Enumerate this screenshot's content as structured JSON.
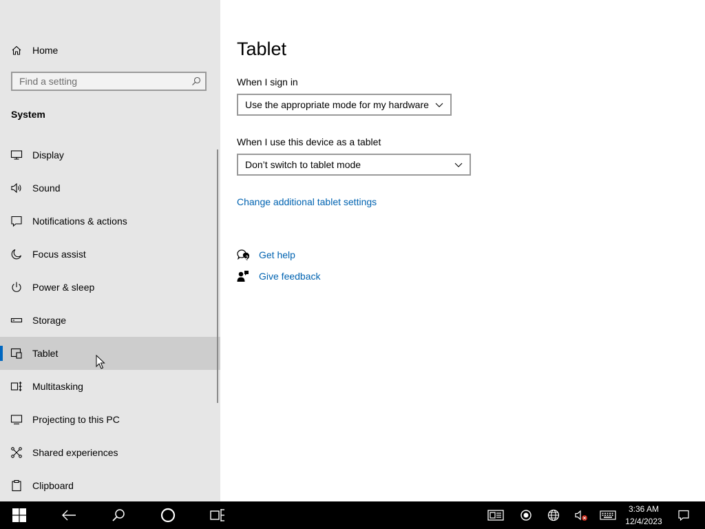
{
  "sidebar": {
    "home_label": "Home",
    "search_placeholder": "Find a setting",
    "section_title": "System",
    "items": [
      {
        "label": "Display",
        "icon": "monitor-icon"
      },
      {
        "label": "Sound",
        "icon": "speaker-icon"
      },
      {
        "label": "Notifications & actions",
        "icon": "notification-icon"
      },
      {
        "label": "Focus assist",
        "icon": "moon-icon"
      },
      {
        "label": "Power & sleep",
        "icon": "power-icon"
      },
      {
        "label": "Storage",
        "icon": "storage-icon"
      },
      {
        "label": "Tablet",
        "icon": "tablet-icon",
        "active": true
      },
      {
        "label": "Multitasking",
        "icon": "multitasking-icon"
      },
      {
        "label": "Projecting to this PC",
        "icon": "projecting-icon"
      },
      {
        "label": "Shared experiences",
        "icon": "shared-icon"
      },
      {
        "label": "Clipboard",
        "icon": "clipboard-icon"
      }
    ]
  },
  "main": {
    "title": "Tablet",
    "sign_in_label": "When I sign in",
    "sign_in_value": "Use the appropriate mode for my hardware",
    "tablet_label": "When I use this device as a tablet",
    "tablet_value": "Don’t switch to tablet mode",
    "additional_link": "Change additional tablet settings",
    "get_help": "Get help",
    "give_feedback": "Give feedback"
  },
  "taskbar": {
    "time": "3:36 AM",
    "date": "12/4/2023"
  },
  "colors": {
    "accent": "#0067c0",
    "link": "#0063b1",
    "sidebar_bg": "#e6e6e6",
    "active_bg": "#cdcdcd"
  }
}
